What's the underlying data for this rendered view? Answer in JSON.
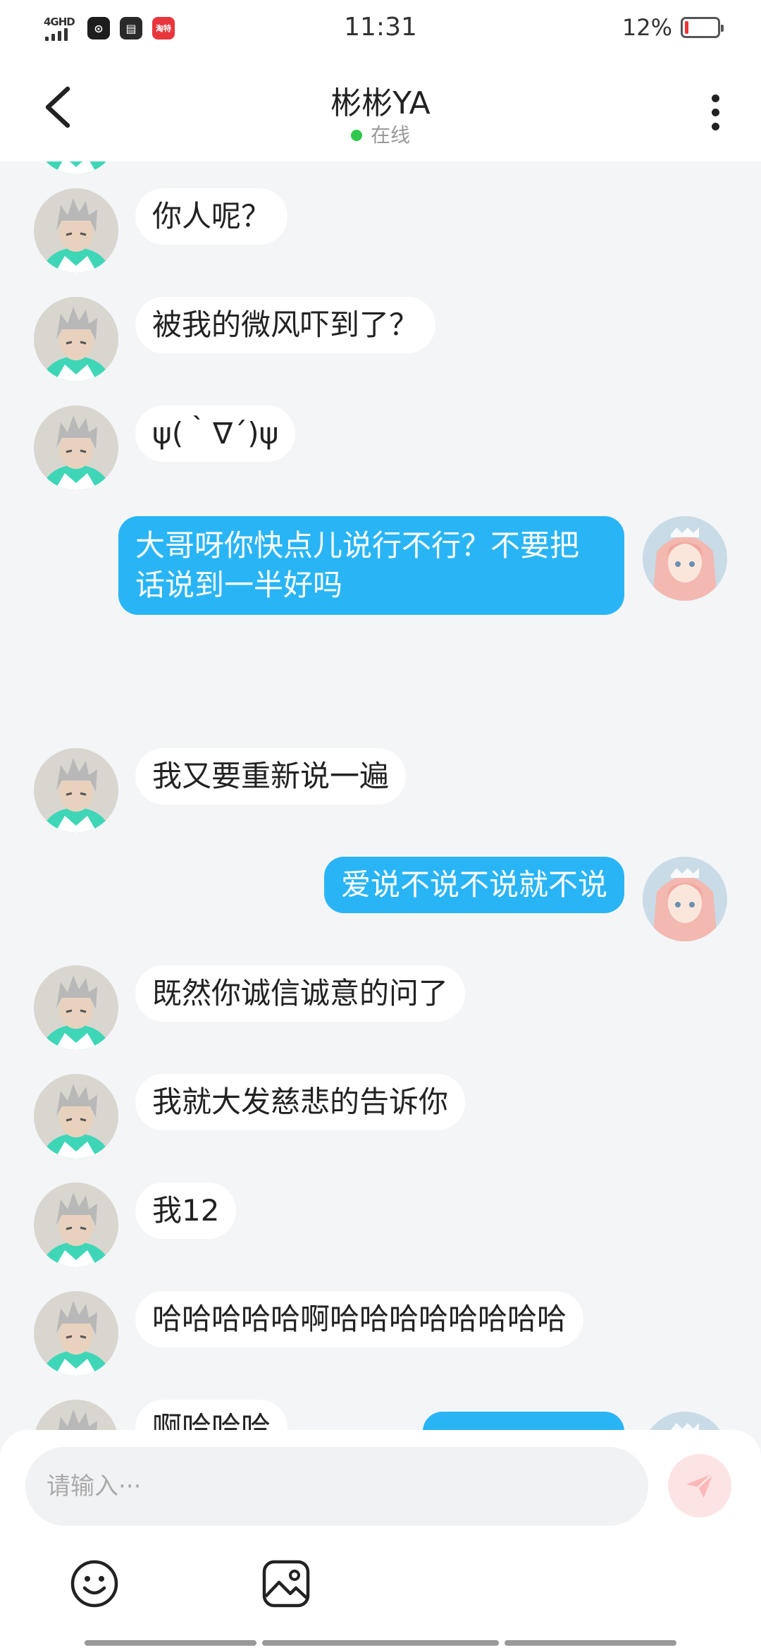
{
  "status_bar": {
    "network": "4GHD",
    "app_icon_3": "淘特",
    "time": "11:31",
    "battery_percent": "12%",
    "battery_level": 0.12
  },
  "header": {
    "title": "彬彬YA",
    "status": "在线"
  },
  "messages": [
    {
      "side": "left",
      "text": "你人呢？"
    },
    {
      "side": "left",
      "text": "被我的微风吓到了？"
    },
    {
      "side": "left",
      "text": "ψ(｀∇´)ψ"
    },
    {
      "side": "right",
      "text": "大哥呀你快点儿说行不行？不要把话说到一半好吗"
    },
    {
      "side": "left",
      "text": "我又要重新说一遍"
    },
    {
      "side": "right",
      "text": "爱说不说不说就不说"
    },
    {
      "side": "left",
      "text": "既然你诚信诚意的问了"
    },
    {
      "side": "left",
      "text": "我就大发慈悲的告诉你"
    },
    {
      "side": "left",
      "text": "我12"
    },
    {
      "side": "left",
      "text": "哈哈哈哈哈啊哈哈哈哈哈哈哈哈"
    },
    {
      "side": "left",
      "text": "啊哈哈哈"
    }
  ],
  "composer": {
    "placeholder": "请输入···"
  },
  "colors": {
    "outgoing_bubble": "#29b5f5",
    "incoming_bubble": "#ffffff",
    "online_dot": "#2ec84a",
    "send_button": "#fde4e4"
  },
  "icons": {
    "back": "chevron-left-icon",
    "more": "more-vertical-icon",
    "send": "paper-plane-icon",
    "emoji": "smiley-icon",
    "image": "image-icon"
  }
}
